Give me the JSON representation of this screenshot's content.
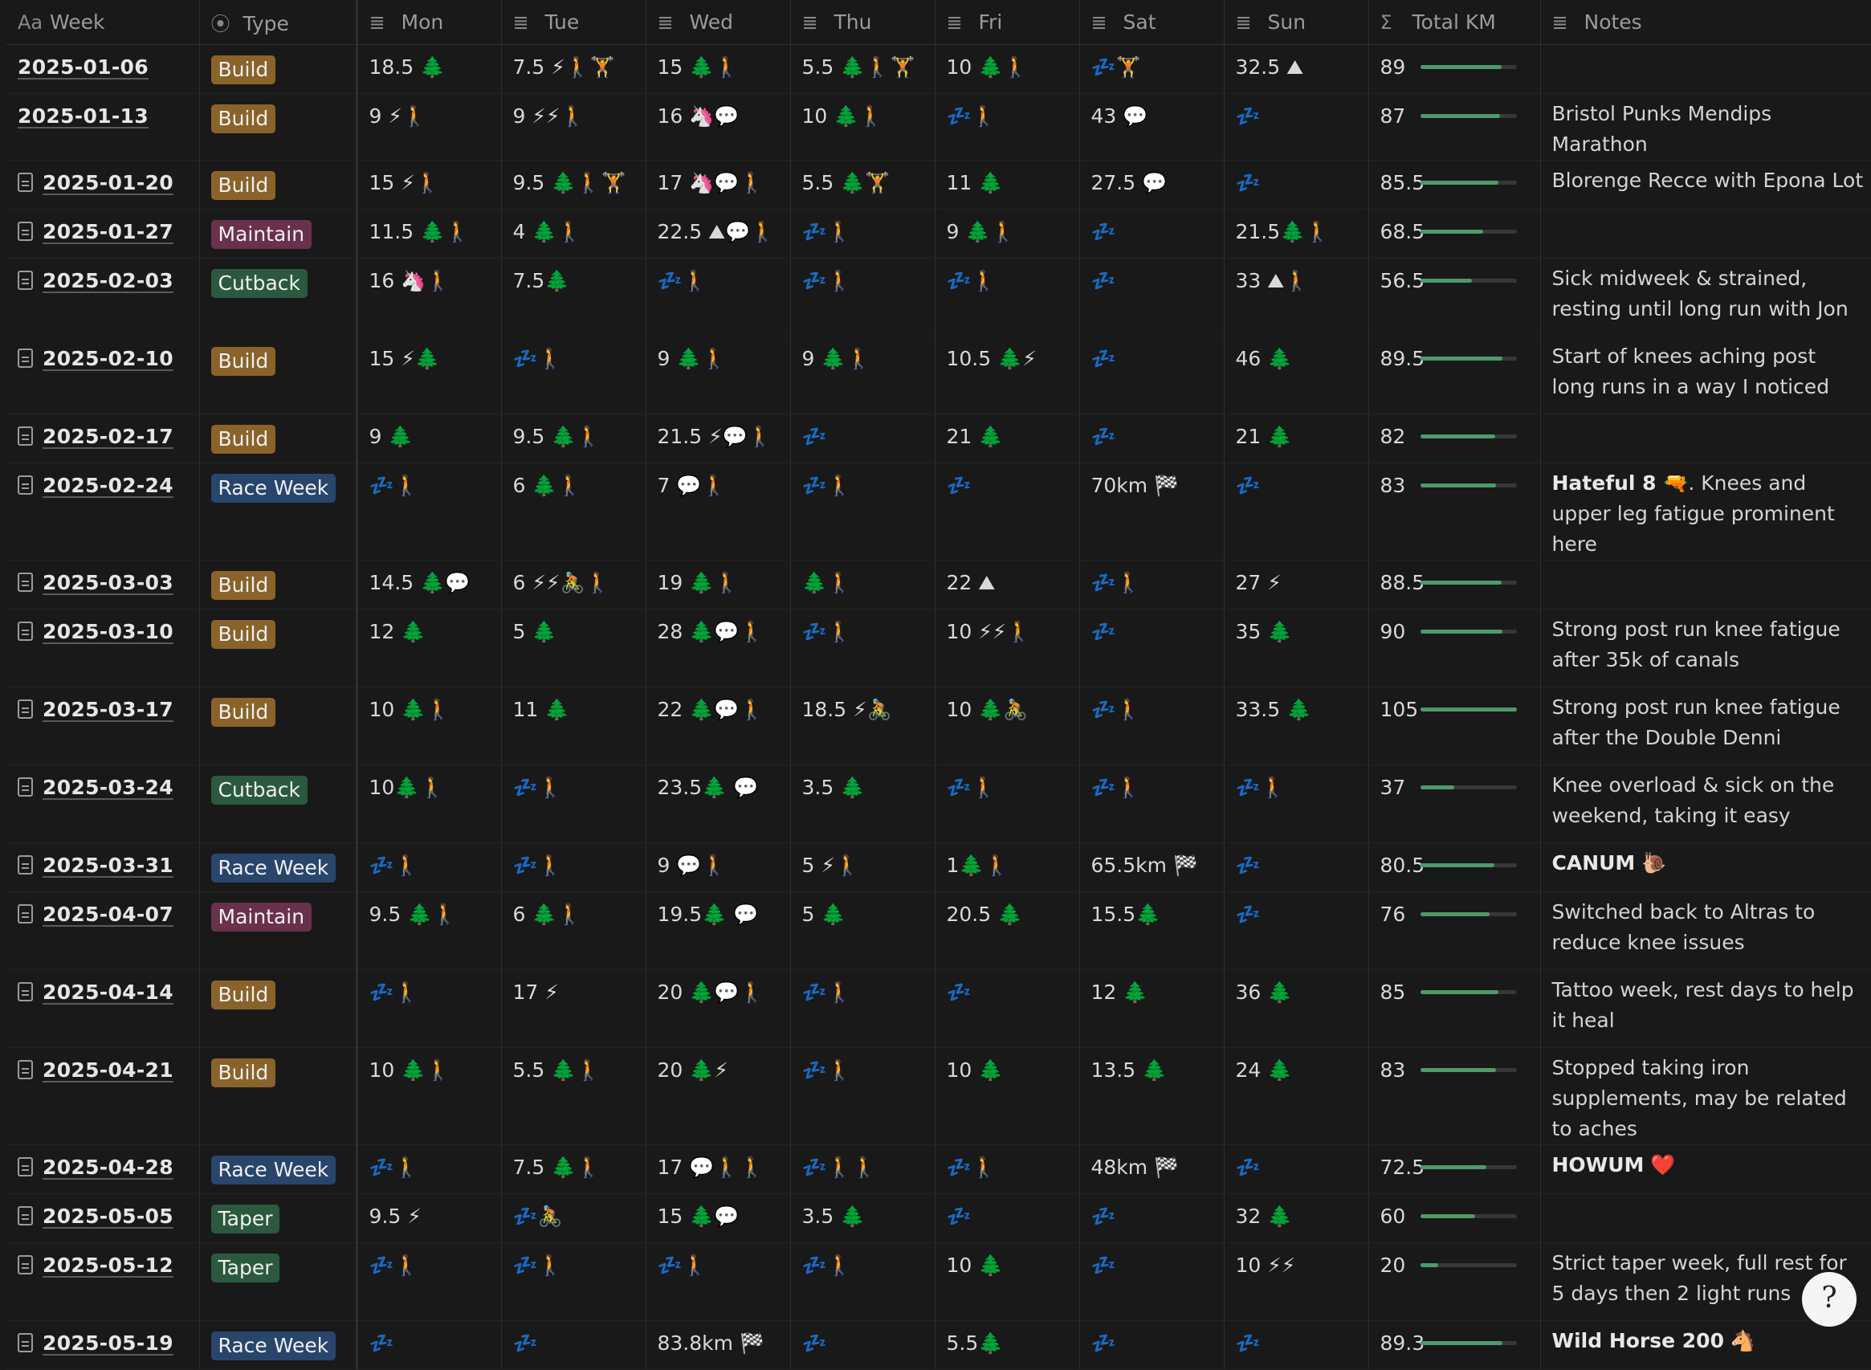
{
  "columns": [
    {
      "icon": "Aa",
      "label": "Week"
    },
    {
      "icon": "⦿",
      "label": "Type"
    },
    {
      "icon": "≣",
      "label": "Mon"
    },
    {
      "icon": "≣",
      "label": "Tue"
    },
    {
      "icon": "≣",
      "label": "Wed"
    },
    {
      "icon": "≣",
      "label": "Thu"
    },
    {
      "icon": "≣",
      "label": "Fri"
    },
    {
      "icon": "≣",
      "label": "Sat"
    },
    {
      "icon": "≣",
      "label": "Sun"
    },
    {
      "icon": "Σ",
      "label": "Total KM"
    },
    {
      "icon": "≣",
      "label": "Notes"
    }
  ],
  "total_max": 105,
  "rows": [
    {
      "week": "2025-01-06",
      "doc": false,
      "type": "Build",
      "days": [
        "18.5 🌲",
        "7.5 ⚡🚶🏋",
        "15 🌲🚶",
        "5.5 🌲🚶🏋",
        "10 🌲🚶",
        "💤🏋",
        "32.5 ⛰"
      ],
      "total": "89",
      "total_value": 89,
      "notes": "",
      "notes_bold": "",
      "tall": false
    },
    {
      "week": "2025-01-13",
      "doc": false,
      "type": "Build",
      "days": [
        "9 ⚡🚶",
        "9 ⚡⚡🚶",
        "16 🦄💬",
        "10 🌲🚶",
        "💤🚶",
        "43 💬",
        "💤"
      ],
      "total": "87",
      "total_value": 87,
      "notes": "Bristol Punks Mendips Marathon",
      "notes_bold": "",
      "tall": false
    },
    {
      "week": "2025-01-20",
      "doc": true,
      "type": "Build",
      "days": [
        "15 ⚡🚶",
        "9.5 🌲🚶🏋",
        "17 🦄💬🚶",
        "5.5 🌲🏋",
        "11 🌲",
        "27.5 💬",
        "💤"
      ],
      "total": "85.5",
      "total_value": 85.5,
      "notes": "Blorenge Recce with Epona Lot",
      "notes_bold": "",
      "tall": false
    },
    {
      "week": "2025-01-27",
      "doc": true,
      "type": "Maintain",
      "days": [
        "11.5 🌲🚶",
        "4 🌲🚶",
        "22.5 ⛰💬🚶",
        "💤🚶",
        "9 🌲🚶",
        "💤",
        "21.5🌲🚶"
      ],
      "total": "68.5",
      "total_value": 68.5,
      "notes": "",
      "notes_bold": "",
      "tall": false
    },
    {
      "week": "2025-02-03",
      "doc": true,
      "type": "Cutback",
      "days": [
        "16 🦄🚶",
        "7.5🌲",
        "💤🚶",
        "💤🚶",
        "💤🚶",
        "💤",
        "33 ⛰🚶"
      ],
      "total": "56.5",
      "total_value": 56.5,
      "notes": "Sick midweek & strained, resting until long run with Jon",
      "notes_bold": "",
      "tall": true
    },
    {
      "week": "2025-02-10",
      "doc": true,
      "type": "Build",
      "days": [
        "15 ⚡🌲",
        "💤🚶",
        "9 🌲🚶",
        "9 🌲🚶",
        "10.5 🌲⚡",
        "💤",
        "46 🌲"
      ],
      "total": "89.5",
      "total_value": 89.5,
      "notes": "Start of knees aching post long runs in a way I noticed",
      "notes_bold": "",
      "tall": true
    },
    {
      "week": "2025-02-17",
      "doc": true,
      "type": "Build",
      "days": [
        "9 🌲",
        "9.5 🌲🚶",
        "21.5 ⚡💬🚶",
        "💤",
        "21 🌲",
        "💤",
        "21 🌲"
      ],
      "total": "82",
      "total_value": 82,
      "notes": "",
      "notes_bold": "",
      "tall": false
    },
    {
      "week": "2025-02-24",
      "doc": true,
      "type": "Race Week",
      "days": [
        "💤🚶",
        "6 🌲🚶",
        "7 💬🚶",
        "💤🚶",
        "💤",
        "70km 🏁",
        "💤"
      ],
      "total": "83",
      "total_value": 83,
      "notes": ". Knees and upper leg fatigue prominent here",
      "notes_bold": "Hateful 8 🔫",
      "tall": true
    },
    {
      "week": "2025-03-03",
      "doc": true,
      "type": "Build",
      "days": [
        "14.5 🌲💬",
        "6 ⚡⚡🚴🚶",
        "19 🌲🚶",
        "🌲🚶",
        "22 ⛰",
        "💤🚶",
        "27 ⚡"
      ],
      "total": "88.5",
      "total_value": 88.5,
      "notes": "",
      "notes_bold": "",
      "tall": false
    },
    {
      "week": "2025-03-10",
      "doc": true,
      "type": "Build",
      "days": [
        "12 🌲",
        "5 🌲",
        "28 🌲💬🚶",
        "💤🚶",
        "10 ⚡⚡🚶",
        "💤",
        "35 🌲"
      ],
      "total": "90",
      "total_value": 90,
      "notes": "Strong post run knee fatigue after 35k of canals",
      "notes_bold": "",
      "tall": true
    },
    {
      "week": "2025-03-17",
      "doc": true,
      "type": "Build",
      "days": [
        "10 🌲🚶",
        "11 🌲",
        "22 🌲💬🚶",
        "18.5 ⚡🚴",
        "10 🌲🚴",
        "💤🚶",
        "33.5 🌲"
      ],
      "total": "105",
      "total_value": 105,
      "notes": "Strong post run knee fatigue after the Double Denni",
      "notes_bold": "",
      "tall": true
    },
    {
      "week": "2025-03-24",
      "doc": true,
      "type": "Cutback",
      "days": [
        "10🌲🚶",
        "💤🚶",
        "23.5🌲 💬",
        "3.5 🌲",
        "💤🚶",
        "💤🚶",
        "💤🚶"
      ],
      "total": "37",
      "total_value": 37,
      "notes": "Knee overload & sick on the weekend, taking it easy",
      "notes_bold": "",
      "tall": true
    },
    {
      "week": "2025-03-31",
      "doc": true,
      "type": "Race Week",
      "days": [
        "💤🚶",
        "💤🚶",
        "9 💬🚶",
        "5 ⚡🚶",
        "1🌲🚶",
        "65.5km 🏁",
        "💤"
      ],
      "total": "80.5",
      "total_value": 80.5,
      "notes": " 🐌",
      "notes_bold": "CANUM",
      "tall": false
    },
    {
      "week": "2025-04-07",
      "doc": true,
      "type": "Maintain",
      "days": [
        "9.5 🌲🚶",
        "6 🌲🚶",
        "19.5🌲 💬",
        "5 🌲",
        "20.5 🌲",
        "15.5🌲",
        "💤"
      ],
      "total": "76",
      "total_value": 76,
      "notes": "Switched back to Altras to reduce knee issues",
      "notes_bold": "",
      "tall": true
    },
    {
      "week": "2025-04-14",
      "doc": true,
      "type": "Build",
      "days": [
        "💤🚶",
        "17 ⚡",
        "20 🌲💬🚶",
        "💤🚶",
        "💤",
        "12 🌲",
        "36 🌲"
      ],
      "total": "85",
      "total_value": 85,
      "notes": "Tattoo week, rest days to help it heal",
      "notes_bold": "",
      "tall": true
    },
    {
      "week": "2025-04-21",
      "doc": true,
      "type": "Build",
      "days": [
        "10 🌲🚶",
        "5.5 🌲🚶",
        "20 🌲⚡",
        "💤🚶",
        "10 🌲",
        "13.5 🌲",
        "24 🌲"
      ],
      "total": "83",
      "total_value": 83,
      "notes": "Stopped taking iron supplements, may be related to aches",
      "notes_bold": "",
      "tall": true
    },
    {
      "week": "2025-04-28",
      "doc": true,
      "type": "Race Week",
      "days": [
        "💤🚶",
        "7.5 🌲🚶",
        "17 💬🚶🚶",
        "💤🚶🚶",
        "💤🚶",
        "48km 🏁",
        "💤"
      ],
      "total": "72.5",
      "total_value": 72.5,
      "notes": " ❤️",
      "notes_bold": "HOWUM",
      "tall": false
    },
    {
      "week": "2025-05-05",
      "doc": true,
      "type": "Taper",
      "days": [
        "9.5 ⚡",
        "💤🚴",
        "15 🌲💬",
        "3.5 🌲",
        "💤",
        "💤",
        "32 🌲"
      ],
      "total": "60",
      "total_value": 60,
      "notes": "",
      "notes_bold": "",
      "tall": false
    },
    {
      "week": "2025-05-12",
      "doc": true,
      "type": "Taper",
      "days": [
        "💤🚶",
        "💤🚶",
        "💤🚶",
        "💤🚶",
        "10 🌲",
        "💤",
        "10 ⚡⚡"
      ],
      "total": "20",
      "total_value": 20,
      "notes": "Strict taper week, full rest for 5 days then 2 light runs",
      "notes_bold": "",
      "tall": true
    },
    {
      "week": "2025-05-19",
      "doc": true,
      "type": "Race Week",
      "days": [
        "💤",
        "💤",
        "83.8km 🏁",
        "💤",
        "5.5🌲",
        "💤",
        "💤"
      ],
      "total": "89.3",
      "total_value": 89.3,
      "notes": " 🐴",
      "notes_bold": "Wild Horse 200",
      "tall": false
    }
  ],
  "help_button": {
    "label": "?"
  }
}
